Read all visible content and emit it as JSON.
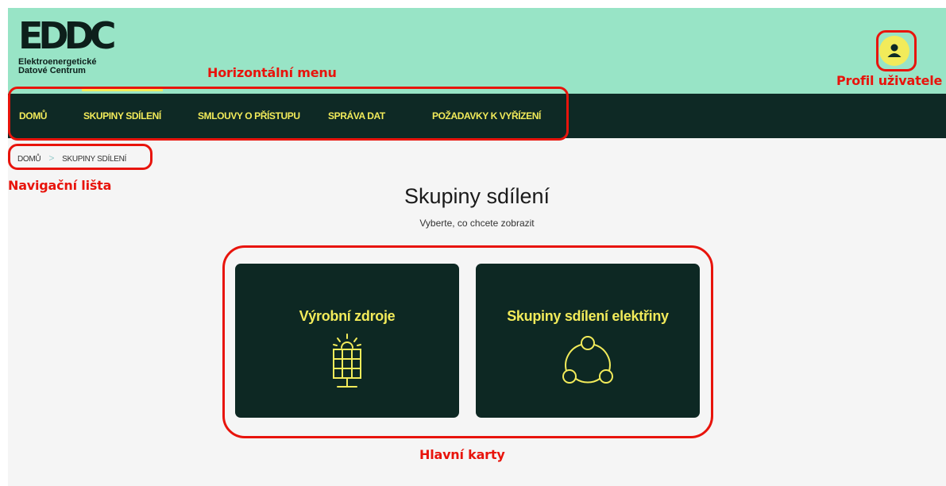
{
  "logo": {
    "mark": "EDDC",
    "line1": "Elektroenergetické",
    "line2": "Datové Centrum"
  },
  "nav": {
    "items": [
      {
        "label": "DOMŮ",
        "active": false
      },
      {
        "label": "SKUPINY SDÍLENÍ",
        "active": true
      },
      {
        "label": "SMLOUVY O PŘÍSTUPU",
        "active": false
      },
      {
        "label": "SPRÁVA DAT",
        "active": false
      },
      {
        "label": "POŽADAVKY K VYŘÍZENÍ",
        "active": false
      }
    ]
  },
  "breadcrumb": {
    "items": [
      "DOMŮ",
      "SKUPINY SDÍLENÍ"
    ],
    "separator": ">"
  },
  "main": {
    "title": "Skupiny sdílení",
    "subtitle": "Vyberte, co chcete zobrazit",
    "cards": [
      {
        "title": "Výrobní zdroje",
        "icon": "solar-panel-icon"
      },
      {
        "title": "Skupiny sdílení elektřiny",
        "icon": "sharing-group-icon"
      }
    ]
  },
  "user": {
    "icon": "user-profile-icon"
  },
  "annotations": {
    "menu": "Horizontální menu",
    "profile": "Profil uživatele",
    "breadcrumb": "Navigační lišta",
    "cards": "Hlavní karty"
  },
  "colors": {
    "header": "#98e4c6",
    "nav": "#0e2925",
    "accent": "#f2eb5a",
    "card": "#0d2823",
    "annotation": "#e8140c"
  }
}
